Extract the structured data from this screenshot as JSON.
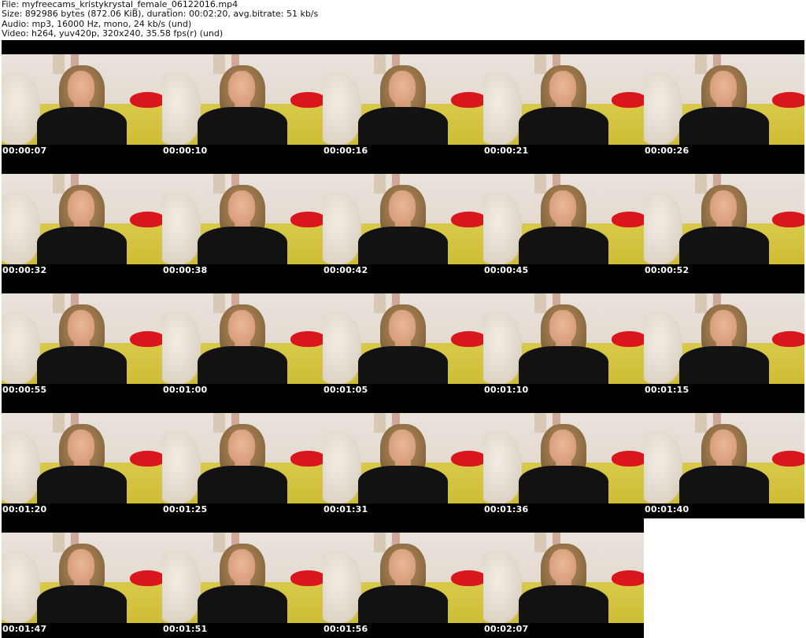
{
  "header": {
    "line1": "File: myfreecams_kristykrystal_female_06122016.mp4",
    "line2": "Size: 892986 bytes (872.06 KiB), duration: 00:02:20, avg.bitrate: 51 kb/s",
    "line3": "Audio: mp3, 16000 Hz, mono, 24 kb/s (und)",
    "line4": "Video: h264, yuv420p, 320x240, 35.58 fps(r) (und)"
  },
  "rows": [
    [
      "00:00:07",
      "00:00:10",
      "00:00:16",
      "00:00:21",
      "00:00:26"
    ],
    [
      "00:00:32",
      "00:00:38",
      "00:00:42",
      "00:00:45",
      "00:00:52"
    ],
    [
      "00:00:55",
      "00:01:00",
      "00:01:05",
      "00:01:10",
      "00:01:15"
    ],
    [
      "00:01:20",
      "00:01:25",
      "00:01:31",
      "00:01:36",
      "00:01:40"
    ],
    [
      "00:01:47",
      "00:01:51",
      "00:01:56",
      "00:02:07"
    ]
  ],
  "colors": {
    "background": "#ffffff",
    "strip": "#000000",
    "timecode": "#ffffff"
  }
}
